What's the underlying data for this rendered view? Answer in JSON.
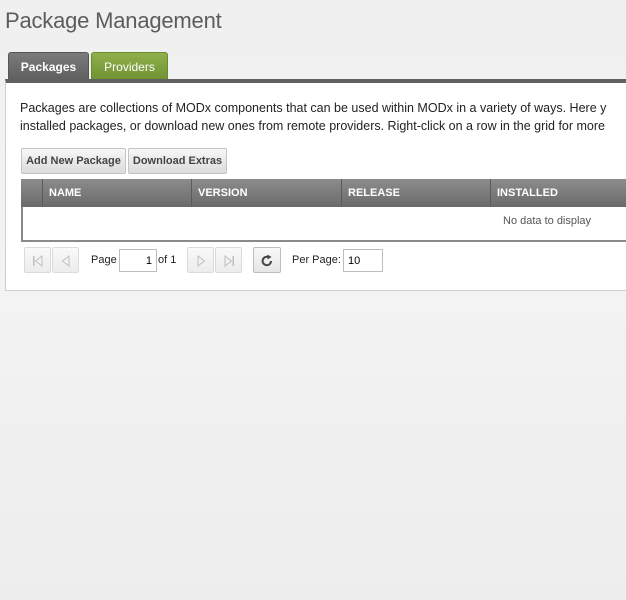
{
  "page": {
    "title": "Package Management"
  },
  "tabs": [
    {
      "label": "Packages",
      "active": true
    },
    {
      "label": "Providers",
      "active": false
    }
  ],
  "description": {
    "line1": "Packages are collections of MODx components that can be used within MODx in a variety of ways. Here y",
    "line2": "installed packages, or download new ones from remote providers. Right-click on a row in the grid for more"
  },
  "toolbar": {
    "add_label": "Add New Package",
    "download_label": "Download Extras"
  },
  "grid": {
    "columns": [
      "NAME",
      "VERSION",
      "RELEASE",
      "INSTALLED"
    ],
    "rows": [],
    "empty_text": "No data to display"
  },
  "pager": {
    "page_label": "Page",
    "page_value": "1",
    "of_label": "of 1",
    "per_page_label": "Per Page:",
    "per_page_value": "10"
  },
  "icons": {
    "first": "first-page-icon",
    "prev": "prev-page-icon",
    "next": "next-page-icon",
    "last": "last-page-icon",
    "refresh": "refresh-icon"
  },
  "colors": {
    "active_tab": "#6a6a6a",
    "providers_tab": "#7fa13d",
    "grid_header": "#777777"
  }
}
